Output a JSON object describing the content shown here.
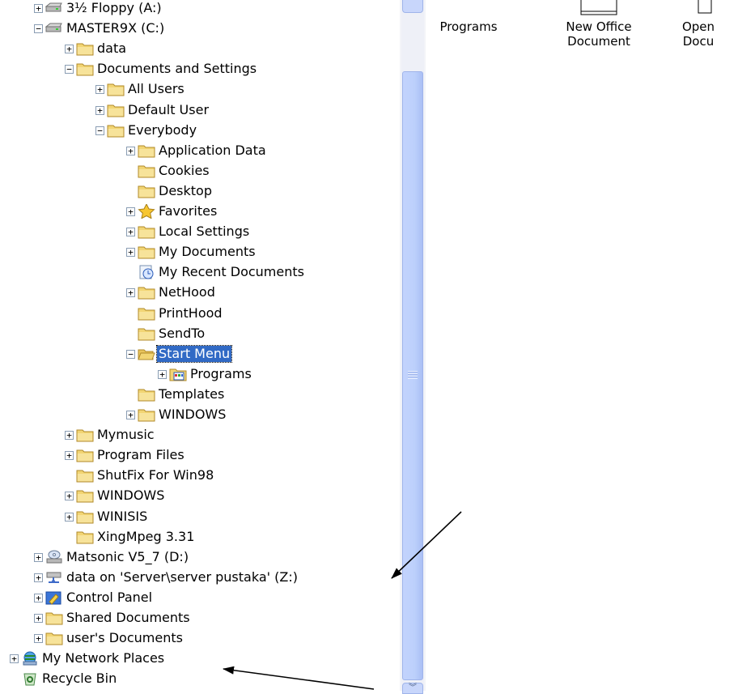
{
  "tree": [
    {
      "label": "3½ Floppy (A:)",
      "depth": 1,
      "expander": "plus",
      "icon": "floppy-drive-icon"
    },
    {
      "label": "MASTER9X (C:)",
      "depth": 1,
      "expander": "minus",
      "icon": "hard-drive-icon"
    },
    {
      "label": "data",
      "depth": 2,
      "expander": "plus",
      "icon": "folder-icon"
    },
    {
      "label": "Documents and Settings",
      "depth": 2,
      "expander": "minus",
      "icon": "folder-icon"
    },
    {
      "label": "All Users",
      "depth": 3,
      "expander": "plus",
      "icon": "folder-icon"
    },
    {
      "label": "Default User",
      "depth": 3,
      "expander": "plus",
      "icon": "folder-icon"
    },
    {
      "label": "Everybody",
      "depth": 3,
      "expander": "minus",
      "icon": "folder-icon"
    },
    {
      "label": "Application Data",
      "depth": 4,
      "expander": "plus",
      "icon": "folder-icon"
    },
    {
      "label": "Cookies",
      "depth": 4,
      "expander": "none",
      "icon": "folder-icon"
    },
    {
      "label": "Desktop",
      "depth": 4,
      "expander": "none",
      "icon": "folder-icon"
    },
    {
      "label": "Favorites",
      "depth": 4,
      "expander": "plus",
      "icon": "favorites-star-icon"
    },
    {
      "label": "Local Settings",
      "depth": 4,
      "expander": "plus",
      "icon": "folder-icon"
    },
    {
      "label": "My Documents",
      "depth": 4,
      "expander": "plus",
      "icon": "folder-icon"
    },
    {
      "label": "My Recent Documents",
      "depth": 4,
      "expander": "none",
      "icon": "recent-documents-icon"
    },
    {
      "label": "NetHood",
      "depth": 4,
      "expander": "plus",
      "icon": "folder-icon"
    },
    {
      "label": "PrintHood",
      "depth": 4,
      "expander": "none",
      "icon": "folder-icon"
    },
    {
      "label": "SendTo",
      "depth": 4,
      "expander": "none",
      "icon": "folder-icon"
    },
    {
      "label": "Start Menu",
      "depth": 4,
      "expander": "minus",
      "icon": "open-folder-icon",
      "selected": true
    },
    {
      "label": "Programs",
      "depth": 5,
      "expander": "plus",
      "icon": "programs-folder-icon"
    },
    {
      "label": "Templates",
      "depth": 4,
      "expander": "none",
      "icon": "folder-icon"
    },
    {
      "label": "WINDOWS",
      "depth": 4,
      "expander": "plus",
      "icon": "folder-icon"
    },
    {
      "label": "Mymusic",
      "depth": 2,
      "expander": "plus",
      "icon": "folder-icon"
    },
    {
      "label": "Program Files",
      "depth": 2,
      "expander": "plus",
      "icon": "folder-icon"
    },
    {
      "label": "ShutFix For Win98",
      "depth": 2,
      "expander": "none",
      "icon": "folder-icon"
    },
    {
      "label": "WINDOWS",
      "depth": 2,
      "expander": "plus",
      "icon": "folder-icon"
    },
    {
      "label": "WINISIS",
      "depth": 2,
      "expander": "plus",
      "icon": "folder-icon"
    },
    {
      "label": "XingMpeg 3.31",
      "depth": 2,
      "expander": "none",
      "icon": "folder-icon"
    },
    {
      "label": "Matsonic V5_7 (D:)",
      "depth": 1,
      "expander": "plus",
      "icon": "cd-drive-icon"
    },
    {
      "label": "data on 'Server\\server pustaka' (Z:)",
      "depth": 1,
      "expander": "plus",
      "icon": "network-drive-icon"
    },
    {
      "label": "Control Panel",
      "depth": 1,
      "expander": "plus",
      "icon": "control-panel-icon"
    },
    {
      "label": "Shared Documents",
      "depth": 1,
      "expander": "plus",
      "icon": "folder-icon"
    },
    {
      "label": "user's Documents",
      "depth": 1,
      "expander": "plus",
      "icon": "folder-icon"
    },
    {
      "label": "My Network Places",
      "depth": 0,
      "expander": "plus",
      "icon": "network-places-icon"
    },
    {
      "label": "Recycle Bin",
      "depth": 0,
      "expander": "none",
      "icon": "recycle-bin-icon"
    }
  ],
  "files": [
    {
      "line1": "Programs",
      "line2": "",
      "icon": "programs-shortcut-icon"
    },
    {
      "line1": "New Office",
      "line2": "Document",
      "icon": "new-office-document-icon"
    },
    {
      "line1": "Open",
      "line2": "Docu",
      "icon": "open-office-document-icon"
    }
  ],
  "colors": {
    "folder": "#f2d574",
    "selection": "#316ac5",
    "scroll_thumb": "#c3d3fd"
  }
}
